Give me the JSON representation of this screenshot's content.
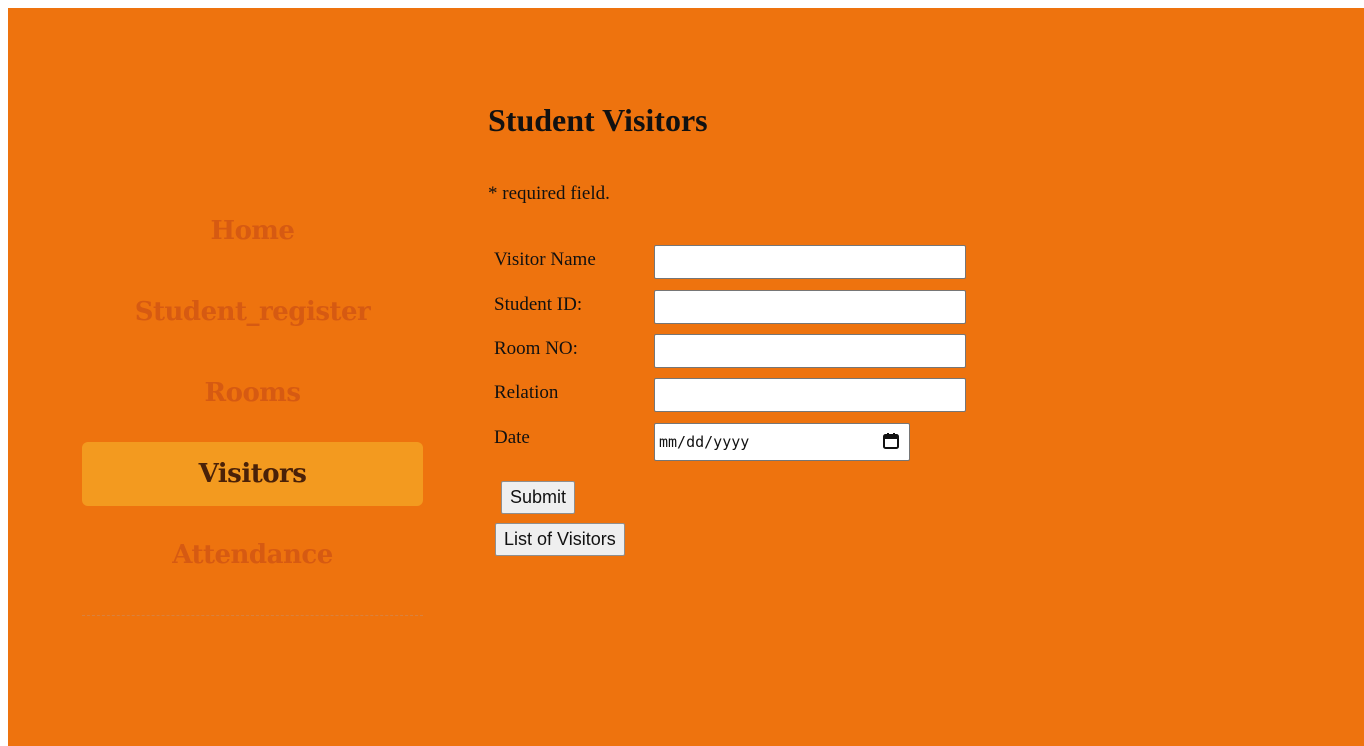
{
  "nav": {
    "items": [
      {
        "label": "Home",
        "active": false
      },
      {
        "label": "Student_register",
        "active": false
      },
      {
        "label": "Rooms",
        "active": false
      },
      {
        "label": "Visitors",
        "active": true
      },
      {
        "label": "Attendance",
        "active": false
      }
    ]
  },
  "main": {
    "title": "Student Visitors",
    "required_note": "* required field.",
    "form": {
      "visitor_name_label": "Visitor Name",
      "visitor_name_value": "",
      "student_id_label": "Student ID:",
      "student_id_value": "",
      "room_no_label": "Room NO:",
      "room_no_value": "",
      "relation_label": "Relation",
      "relation_value": "",
      "date_label": "Date",
      "date_placeholder": "mm/dd/yyyy",
      "submit_label": "Submit",
      "list_label": "List of Visitors"
    }
  },
  "colors": {
    "background": "#ee730e",
    "nav_text": "#d65a12",
    "nav_active_bg": "#f39a1f",
    "nav_active_text": "#4a2108"
  },
  "icons": {
    "date_picker": "calendar-icon"
  }
}
